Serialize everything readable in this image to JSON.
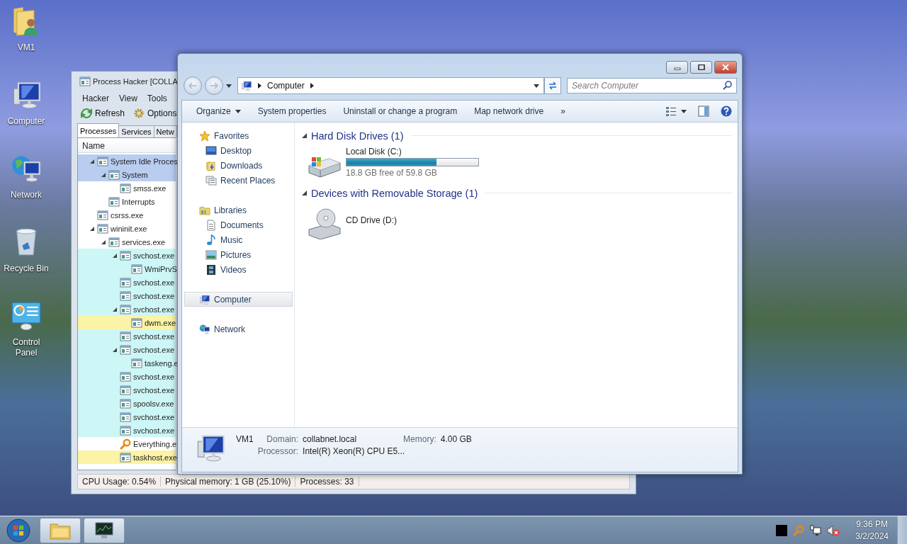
{
  "desktop_icons": [
    {
      "label": "VM1"
    },
    {
      "label": "Computer"
    },
    {
      "label": "Network"
    },
    {
      "label": "Recycle Bin"
    },
    {
      "label": "Control Panel"
    }
  ],
  "process_hacker": {
    "title": "Process Hacker [COLLA",
    "menu": [
      "Hacker",
      "View",
      "Tools"
    ],
    "toolbar": [
      "Refresh",
      "Options"
    ],
    "tabs": [
      {
        "label": "Processes",
        "selected": true
      },
      {
        "label": "Services",
        "selected": false
      },
      {
        "label": "Netw",
        "selected": false
      }
    ],
    "column": "Name",
    "processes": [
      {
        "name": "System Idle Proces",
        "selected": true,
        "expanded": true,
        "children": [
          {
            "name": "System",
            "selected": true,
            "expanded": true,
            "children": [
              {
                "name": "smss.exe",
                "selected": false
              }
            ]
          },
          {
            "name": "Interrupts",
            "selected": false
          }
        ]
      },
      {
        "name": "csrss.exe",
        "selected": false
      },
      {
        "name": "wininit.exe",
        "selected": false,
        "expanded": true,
        "children": [
          {
            "name": "services.exe",
            "selected": false,
            "expanded": true,
            "children": [
              {
                "name": "svchost.exe",
                "selected": false,
                "color": "#cdf6f6",
                "expanded": true,
                "children": [
                  {
                    "name": "WmiPrvS",
                    "selected": false,
                    "color": "#cdf6f6"
                  }
                ]
              },
              {
                "name": "svchost.exe",
                "selected": false,
                "color": "#cdf6f6"
              },
              {
                "name": "svchost.exe",
                "selected": false,
                "color": "#cdf6f6"
              },
              {
                "name": "svchost.exe",
                "selected": false,
                "color": "#cdf6f6",
                "expanded": true,
                "children": [
                  {
                    "name": "dwm.exe",
                    "selected": false,
                    "color": "#fbf3a6"
                  }
                ]
              },
              {
                "name": "svchost.exe",
                "selected": false,
                "color": "#cdf6f6"
              },
              {
                "name": "svchost.exe",
                "selected": false,
                "color": "#cdf6f6",
                "expanded": true,
                "children": [
                  {
                    "name": "taskeng.e",
                    "selected": false,
                    "color": "#cdf6f6"
                  }
                ]
              },
              {
                "name": "svchost.exe",
                "selected": false,
                "color": "#cdf6f6"
              },
              {
                "name": "svchost.exe",
                "selected": false,
                "color": "#cdf6f6"
              },
              {
                "name": "spoolsv.exe",
                "selected": false,
                "color": "#cdf6f6"
              },
              {
                "name": "svchost.exe",
                "selected": false,
                "color": "#cdf6f6"
              },
              {
                "name": "svchost.exe",
                "selected": false,
                "color": "#cdf6f6"
              },
              {
                "name": "Everything.e",
                "selected": false
              },
              {
                "name": "taskhost.exe",
                "selected": false,
                "color": "#fbf3a6"
              }
            ]
          }
        ]
      }
    ],
    "status_bar": [
      "CPU Usage: 0.54%",
      "Physical memory: 1 GB (25.10%)",
      "Processes: 33"
    ]
  },
  "explorer": {
    "address": [
      "Computer"
    ],
    "search": {
      "placeholder": "Search Computer"
    },
    "toolbar": [
      {
        "label": "Organize",
        "dropdown": true
      },
      {
        "label": "System properties",
        "dropdown": false
      },
      {
        "label": "Uninstall or change a program",
        "dropdown": false
      },
      {
        "label": "Map network drive",
        "dropdown": false
      },
      {
        "label": "»",
        "dropdown": false
      }
    ],
    "sidebar": [
      {
        "label": "Favorites",
        "selected": false,
        "children": [
          {
            "label": "Desktop",
            "selected": false
          },
          {
            "label": "Downloads",
            "selected": false
          },
          {
            "label": "Recent Places",
            "selected": false
          }
        ]
      },
      {
        "label": "Libraries",
        "selected": false,
        "children": [
          {
            "label": "Documents",
            "selected": false
          },
          {
            "label": "Music",
            "selected": false
          },
          {
            "label": "Pictures",
            "selected": false
          },
          {
            "label": "Videos",
            "selected": false
          }
        ]
      },
      {
        "label": "Computer",
        "selected": true
      },
      {
        "label": "Network",
        "selected": false
      }
    ],
    "groups": [
      {
        "title": "Hard Disk Drives (1)",
        "expanded": true,
        "drives": [
          {
            "name": "Local Disk (C:)",
            "level": 0.685,
            "space": "18.8 GB free of 59.8 GB"
          }
        ]
      },
      {
        "title": "Devices with Removable Storage (1)",
        "expanded": true,
        "drives": [
          {
            "name": "CD Drive (D:)"
          }
        ]
      }
    ],
    "details": {
      "name": "VM1",
      "fields": [
        {
          "label": "Domain:",
          "value": "collabnet.local"
        },
        {
          "label": "Memory:",
          "value": "4.00 GB"
        },
        {
          "label": "Processor:",
          "value": "Intel(R) Xeon(R) CPU E5..."
        }
      ]
    }
  },
  "taskbar": {
    "time": "9:36 PM",
    "date": "3/2/2024"
  }
}
